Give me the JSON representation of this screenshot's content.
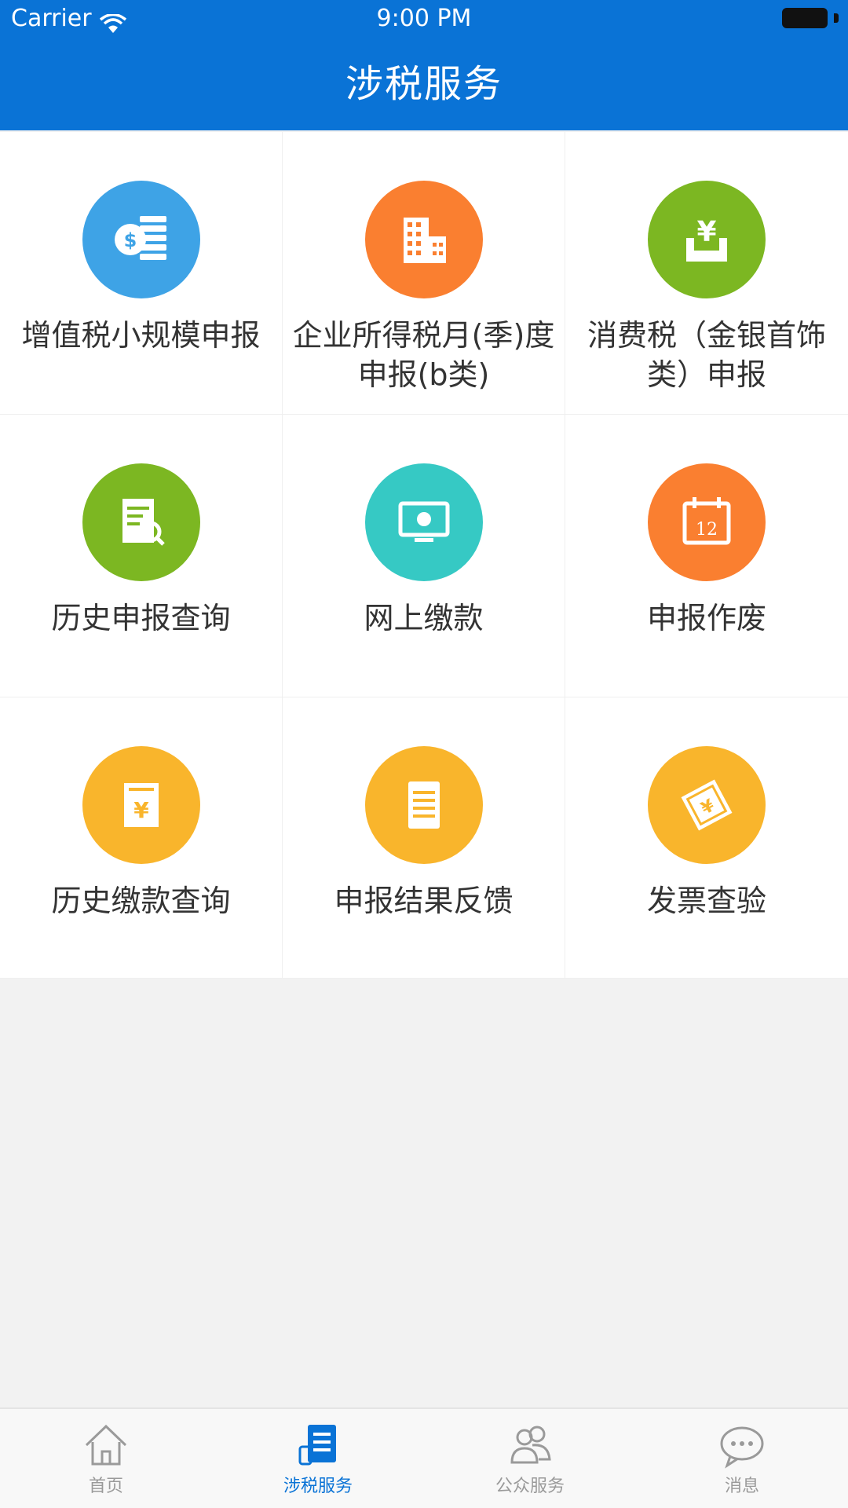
{
  "status_bar": {
    "carrier": "Carrier",
    "time": "9:00 PM"
  },
  "header": {
    "title": "涉税服务"
  },
  "colors": {
    "header_bg": "#0a73d6",
    "blue": "#3ea3e6",
    "orange": "#fa7f30",
    "green": "#7cb722",
    "teal": "#36c9c4",
    "yellow": "#f9b52c"
  },
  "grid": {
    "items": [
      {
        "label": "增值税小规模申报",
        "icon": "coin-stack-icon",
        "color": "#3ea3e6"
      },
      {
        "label": "企业所得税月(季)度申报(b类)",
        "icon": "building-icon",
        "color": "#fa7f30"
      },
      {
        "label": "消费税（金银首饰类）申报",
        "icon": "yen-tray-icon",
        "color": "#7cb722"
      },
      {
        "label": "历史申报查询",
        "icon": "document-search-icon",
        "color": "#7cb722"
      },
      {
        "label": "网上缴款",
        "icon": "monitor-payment-icon",
        "color": "#36c9c4"
      },
      {
        "label": "申报作废",
        "icon": "calendar-icon",
        "color": "#fa7f30"
      },
      {
        "label": "历史缴款查询",
        "icon": "yen-document-icon",
        "color": "#f9b52c"
      },
      {
        "label": "申报结果反馈",
        "icon": "list-document-icon",
        "color": "#f9b52c"
      },
      {
        "label": "发票查验",
        "icon": "invoice-ticket-icon",
        "color": "#f9b52c"
      }
    ]
  },
  "tabbar": {
    "items": [
      {
        "label": "首页",
        "icon": "home-icon",
        "active": false
      },
      {
        "label": "涉税服务",
        "icon": "tax-service-icon",
        "active": true
      },
      {
        "label": "公众服务",
        "icon": "public-service-icon",
        "active": false
      },
      {
        "label": "消息",
        "icon": "message-icon",
        "active": false
      }
    ]
  },
  "icon_texts": {
    "calendar_day": "12",
    "yen": "¥"
  }
}
